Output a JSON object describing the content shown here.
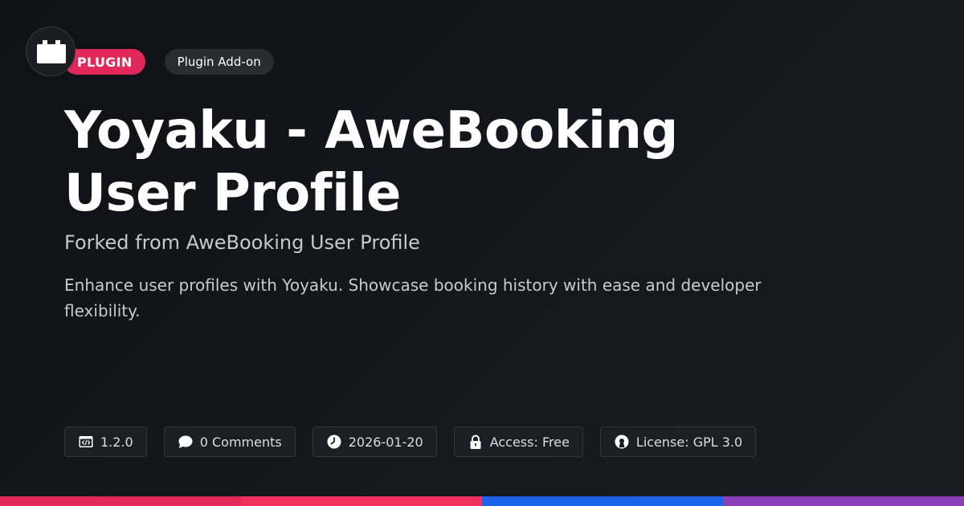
{
  "header": {
    "logo_icon": "plugin-block-icon",
    "category_badge": "PLUGIN",
    "type_badge": "Plugin Add-on"
  },
  "main": {
    "title": "Yoyaku - AweBooking User Profile",
    "subtitle": "Forked from AweBooking User Profile",
    "description": "Enhance user profiles with Yoyaku. Showcase booking history with ease and developer flexibility."
  },
  "meta": {
    "version": {
      "icon": "code-window-icon",
      "label": "1.2.0"
    },
    "comments": {
      "icon": "chat-bubble-icon",
      "label": "0 Comments"
    },
    "date": {
      "icon": "clock-icon",
      "label": "2026-01-20"
    },
    "access": {
      "icon": "lock-icon",
      "label": "Access: Free"
    },
    "license": {
      "icon": "open-source-icon",
      "label": "License: GPL 3.0"
    }
  },
  "colors": {
    "accent": "#e2285a",
    "bar_segments": [
      "#e2285a",
      "#f0305e",
      "#1a64ea",
      "#8a3fb8"
    ]
  }
}
